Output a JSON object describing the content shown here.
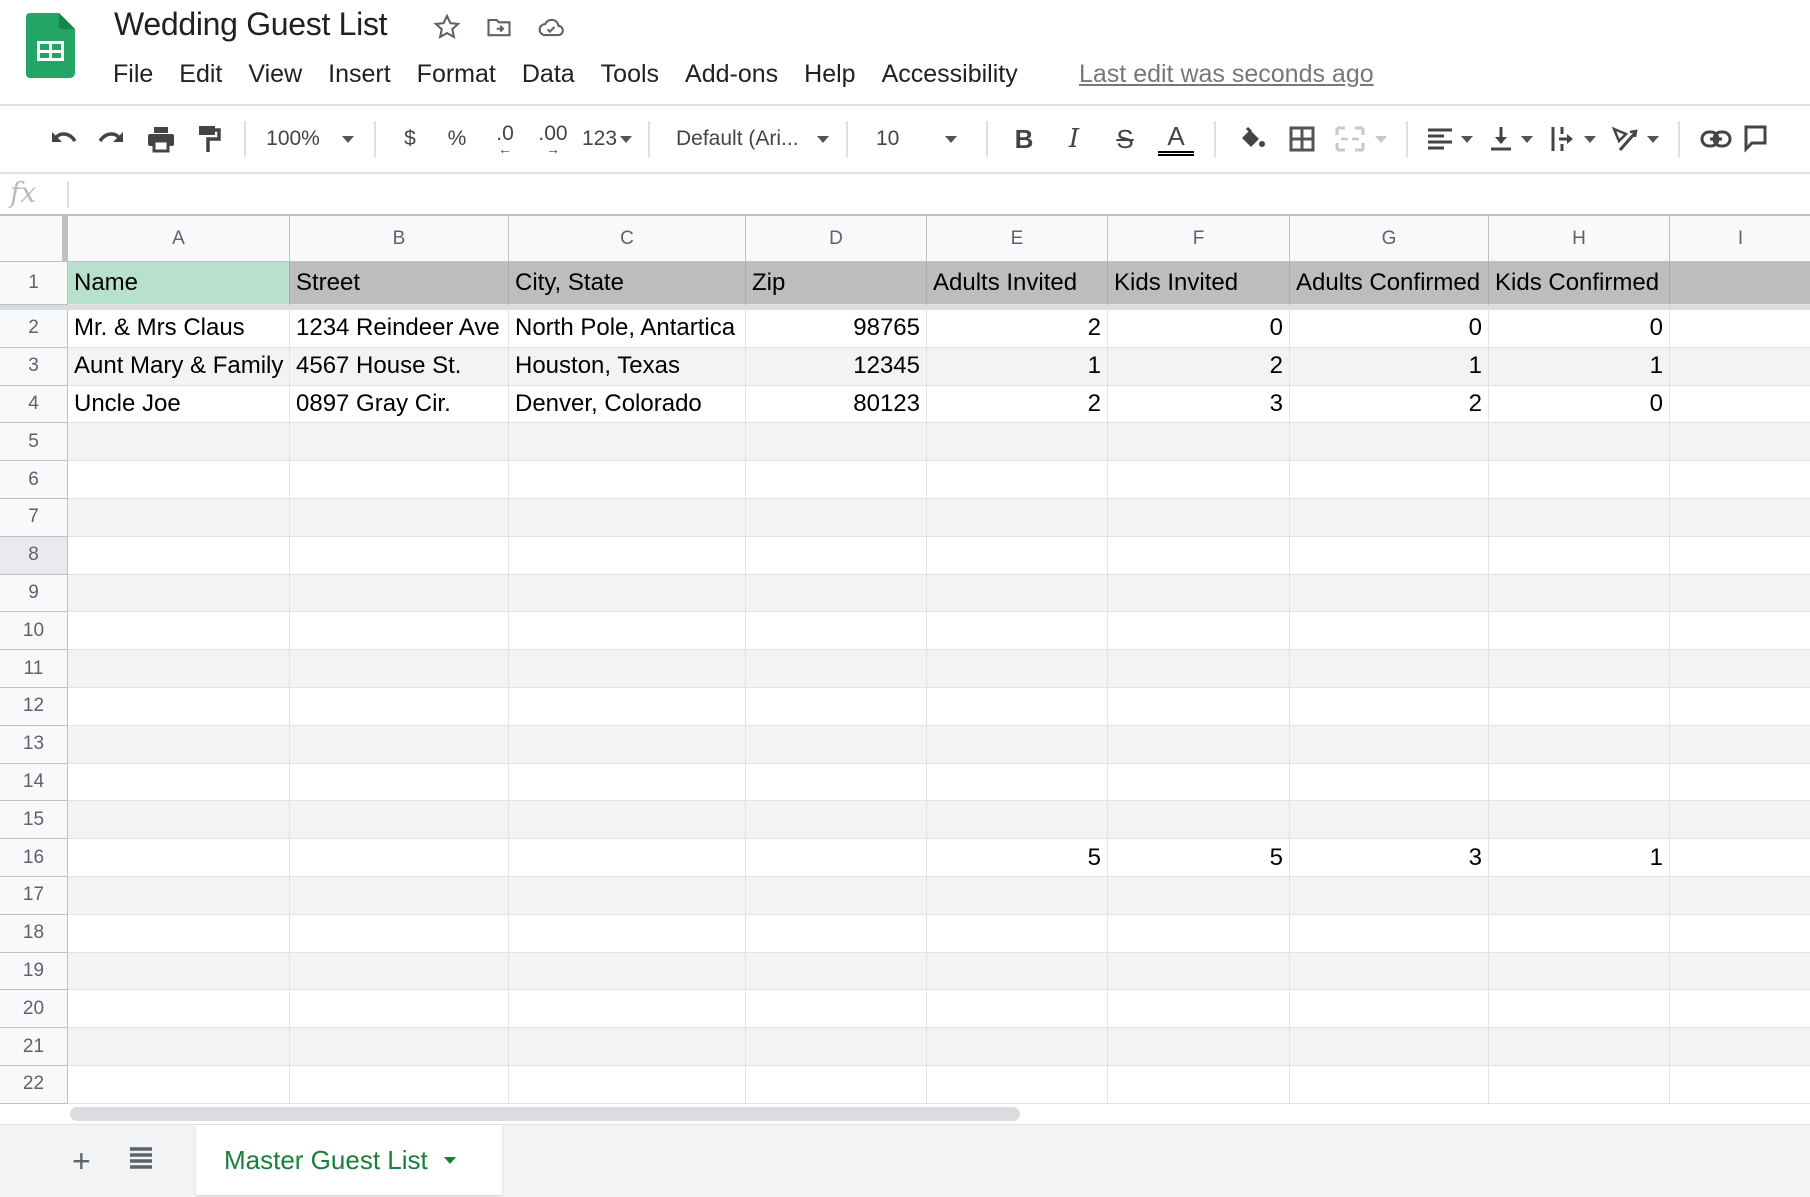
{
  "app": {
    "title": "Wedding Guest List",
    "last_edit": "Last edit was seconds ago",
    "title_icons": [
      "star-icon",
      "move-to-folder-icon",
      "cloud-saved-icon"
    ]
  },
  "menu": [
    "File",
    "Edit",
    "View",
    "Insert",
    "Format",
    "Data",
    "Tools",
    "Add-ons",
    "Help",
    "Accessibility"
  ],
  "toolbar": {
    "zoom": "100%",
    "currency": "$",
    "percent": "%",
    "decrease_decimal": ".0",
    "increase_decimal": ".00",
    "more_formats": "123",
    "font": "Default (Ari...",
    "font_size": "10",
    "bold": "B",
    "italic": "I",
    "strikethrough": "S",
    "text_color": "A"
  },
  "formula_bar": {
    "label": "fx",
    "value": ""
  },
  "columns": [
    "A",
    "B",
    "C",
    "D",
    "E",
    "F",
    "G",
    "H",
    "I"
  ],
  "row_numbers": [
    "1",
    "2",
    "3",
    "4",
    "5",
    "6",
    "7",
    "8",
    "9",
    "10",
    "11",
    "12",
    "13",
    "14",
    "15",
    "16",
    "17",
    "18",
    "19",
    "20",
    "21",
    "22"
  ],
  "header_row": [
    "Name",
    "Street",
    "City, State",
    "Zip",
    "Adults Invited",
    "Kids Invited",
    "Adults Confirmed",
    "Kids Confirmed",
    ""
  ],
  "rows": [
    [
      "Mr. & Mrs Claus",
      "1234 Reindeer Ave",
      "North Pole, Antartica",
      "98765",
      "2",
      "0",
      "0",
      "0",
      ""
    ],
    [
      "Aunt Mary & Family",
      "4567 House St.",
      "Houston, Texas",
      "12345",
      "1",
      "2",
      "1",
      "1",
      ""
    ],
    [
      "Uncle Joe",
      "0897 Gray Cir.",
      "Denver, Colorado",
      "80123",
      "2",
      "3",
      "2",
      "0",
      ""
    ]
  ],
  "totals_row": {
    "row": "16",
    "values": [
      "",
      "",
      "",
      "",
      "5",
      "5",
      "3",
      "1",
      ""
    ]
  },
  "sheet_tabs": [
    {
      "label": "Master Guest List",
      "active": true
    }
  ],
  "colors": {
    "brand_green": "#0f9d58",
    "header_fill": "#bdbdbd",
    "name_header_fill": "#b7e1cd",
    "band_fill": "#f3f3f3",
    "sheet_tab_text": "#188038"
  }
}
